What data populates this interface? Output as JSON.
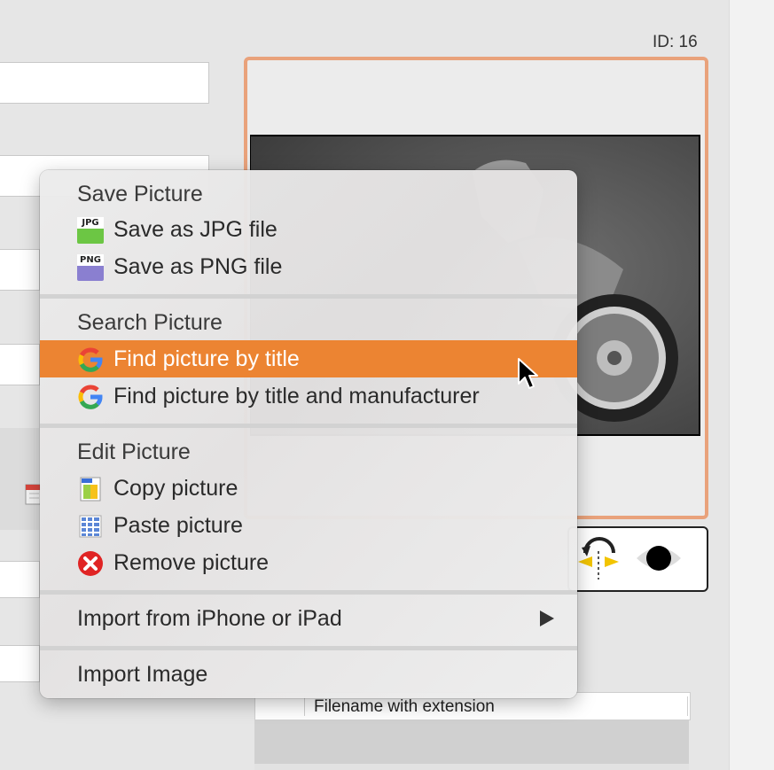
{
  "record": {
    "id_label": "ID: 16"
  },
  "table": {
    "header_filename": "Filename with extension"
  },
  "context_menu": {
    "sections": [
      {
        "header": "Save Picture",
        "items": [
          {
            "label": "Save as JPG file",
            "icon": "jpg-file-icon",
            "icon_text": "JPG",
            "color": "#6cc644"
          },
          {
            "label": "Save as PNG file",
            "icon": "png-file-icon",
            "icon_text": "PNG",
            "color": "#8a7fd0"
          }
        ]
      },
      {
        "header": "Search Picture",
        "items": [
          {
            "label": "Find picture by title",
            "icon": "google-icon",
            "highlighted": true
          },
          {
            "label": "Find picture by title and manufacturer",
            "icon": "google-icon"
          }
        ]
      },
      {
        "header": "Edit Picture",
        "items": [
          {
            "label": "Copy picture",
            "icon": "copy-picture-icon"
          },
          {
            "label": "Paste picture",
            "icon": "paste-picture-icon"
          },
          {
            "label": "Remove picture",
            "icon": "remove-icon"
          }
        ]
      }
    ],
    "import_device": "Import from iPhone or iPad",
    "import_image": "Import Image",
    "highlight_color": "#ec8432"
  },
  "colors": {
    "frame_accent": "#e9a27b"
  }
}
